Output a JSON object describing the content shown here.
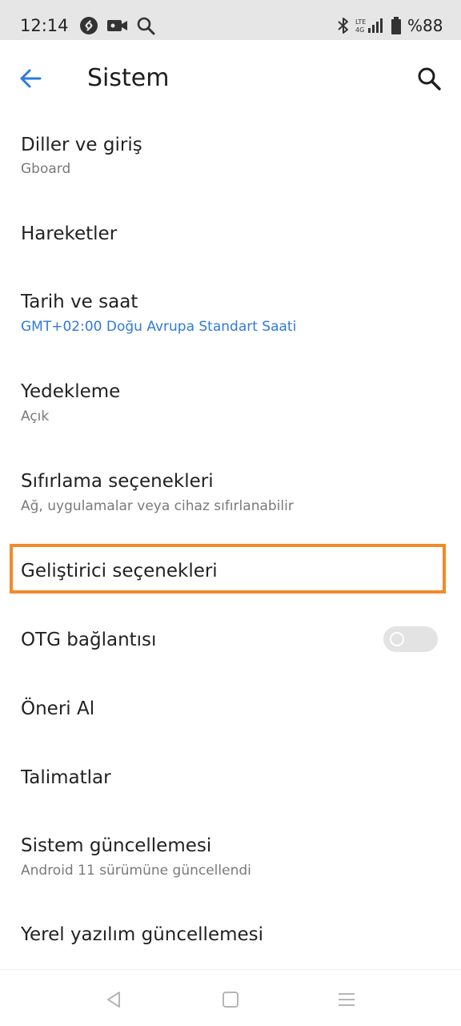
{
  "status_bar": {
    "time": "12:14",
    "battery": "%88",
    "icons": [
      "shazam-icon",
      "video-camera-icon",
      "search-icon",
      "bluetooth-icon",
      "lte-signal-icon",
      "battery-icon"
    ]
  },
  "app_bar": {
    "title": "Sistem",
    "back_icon": "arrow-left-icon",
    "search_icon": "search-icon",
    "accent": "#2f7bd8"
  },
  "settings": [
    {
      "title": "Diller ve giriş",
      "subtitle": "Gboard"
    },
    {
      "title": "Hareketler"
    },
    {
      "title": "Tarih ve saat",
      "subtitle": "GMT+02:00 Doğu Avrupa Standart Saati"
    },
    {
      "title": "Yedekleme",
      "subtitle": "Açık"
    },
    {
      "title": "Sıfırlama seçenekleri",
      "subtitle": "Ağ, uygulamalar veya cihaz sıfırlanabilir"
    },
    {
      "title": "Geliştirici seçenekleri",
      "highlight_color": "#f28a2a"
    },
    {
      "title": "OTG bağlantısı",
      "toggle_on": false
    },
    {
      "title": "Öneri Al"
    },
    {
      "title": "Talimatlar"
    },
    {
      "title": "Sistem güncellemesi",
      "subtitle": "Android 11 sürümüne güncellendi"
    },
    {
      "title": "Yerel yazılım güncellemesi"
    }
  ],
  "nav_bar": {
    "icons": [
      "back-triangle-icon",
      "home-square-icon",
      "menu-lines-icon"
    ]
  }
}
